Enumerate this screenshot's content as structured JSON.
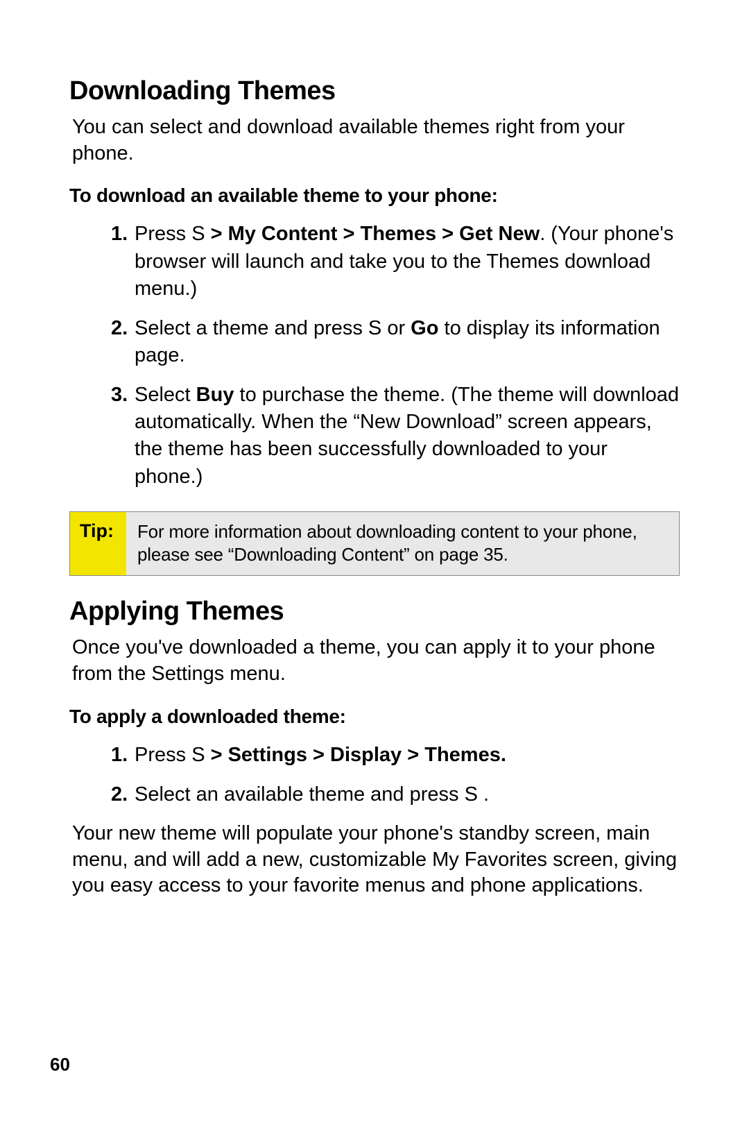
{
  "section1": {
    "heading": "Downloading Themes",
    "intro": "You can select and download available themes right from your phone.",
    "subheading": "To download an available theme to your phone:",
    "steps": {
      "s1_pre": "Press ",
      "s1_key": "S",
      "s1_boldnav": " > My Content > Themes > Get New",
      "s1_post": ". (Your phone's browser will launch and take you to the Themes download menu.)",
      "s2_pre": "Select a theme and press ",
      "s2_key": "S",
      "s2_mid": " or ",
      "s2_bold": "Go",
      "s2_post": " to display its information page.",
      "s3_pre": "Select ",
      "s3_bold": "Buy",
      "s3_post": " to purchase the theme. (The theme will download automatically. When the “New Download” screen appears, the theme has been successfully downloaded to your phone.)"
    }
  },
  "tip": {
    "label": "Tip:",
    "content": "For more information about downloading content to your phone, please see “Downloading Content” on page 35."
  },
  "section2": {
    "heading": "Applying Themes",
    "intro": "Once you've downloaded a theme, you can apply it to your phone from the Settings menu.",
    "subheading": "To apply a downloaded theme:",
    "steps": {
      "s1_pre": "Press ",
      "s1_key": "S",
      "s1_boldnav": " > Settings > Display > Themes",
      "s1_post": ".",
      "s2_pre": "Select an available theme and press ",
      "s2_key": "S",
      "s2_post": " ."
    },
    "outro": "Your new theme will populate your phone's standby screen, main menu, and will add a new, customizable My Favorites screen, giving you easy access to your favorite menus and phone applications."
  },
  "pageNumber": "60"
}
